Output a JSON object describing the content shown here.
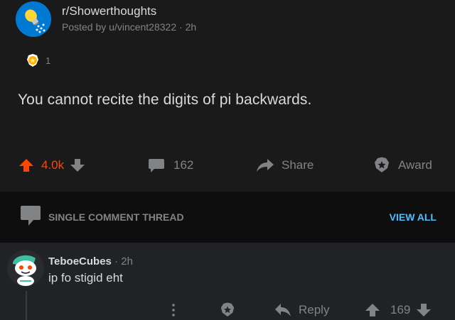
{
  "post": {
    "subreddit": "r/Showerthoughts",
    "posted_by": "Posted by u/vincent28322",
    "time": "2h",
    "award_count": "1",
    "title": "You cannot recite the digits of pi backwards.",
    "upvotes": "4.0k",
    "comments": "162",
    "share_label": "Share",
    "award_label": "Award"
  },
  "thread": {
    "label": "SINGLE COMMENT THREAD",
    "view_all": "VIEW ALL"
  },
  "comment": {
    "username": "TeboeCubes",
    "time": "2h",
    "text": "ip fo stigid eht",
    "reply_label": "Reply",
    "votes": "169"
  },
  "colors": {
    "background": "#1a1a1b",
    "upvote": "#ff4500",
    "link": "#4fbcff",
    "muted": "#818384"
  }
}
